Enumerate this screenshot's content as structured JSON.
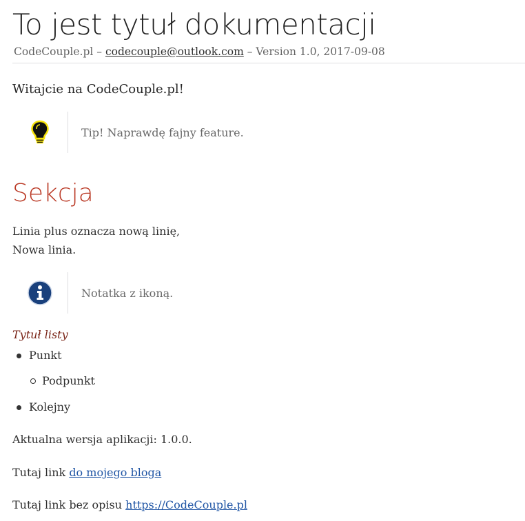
{
  "header": {
    "title": "To jest tytuł dokumentacji",
    "author": "CodeCouple.pl",
    "sep1": " – ",
    "email": "codecouple@outlook.com",
    "sep2": " – ",
    "revision": "Version 1.0, 2017-09-08"
  },
  "intro": "Witajcie na CodeCouple.pl!",
  "tip": {
    "icon": "lightbulb-icon",
    "text": "Tip! Naprawdę fajny feature."
  },
  "section": {
    "title": "Sekcja",
    "line1": "Linia plus oznacza nową linię,",
    "line2": "Nowa linia."
  },
  "note": {
    "icon": "info-icon",
    "text": "Notatka z ikoną."
  },
  "list": {
    "title": "Tytuł listy",
    "items": [
      "Punkt",
      "Podpunkt",
      "Kolejny"
    ]
  },
  "version_text": "Aktualna wersja aplikacji: 1.0.0.",
  "link1": {
    "prefix": "Tutaj link ",
    "text": "do mojego bloga"
  },
  "link2": {
    "prefix": "Tutaj link bez opisu ",
    "text": "https://CodeCouple.pl"
  },
  "colors": {
    "section_title": "#ba3925",
    "link": "#2156a5",
    "list_title": "#7a2518",
    "note_icon": "#19407c"
  }
}
